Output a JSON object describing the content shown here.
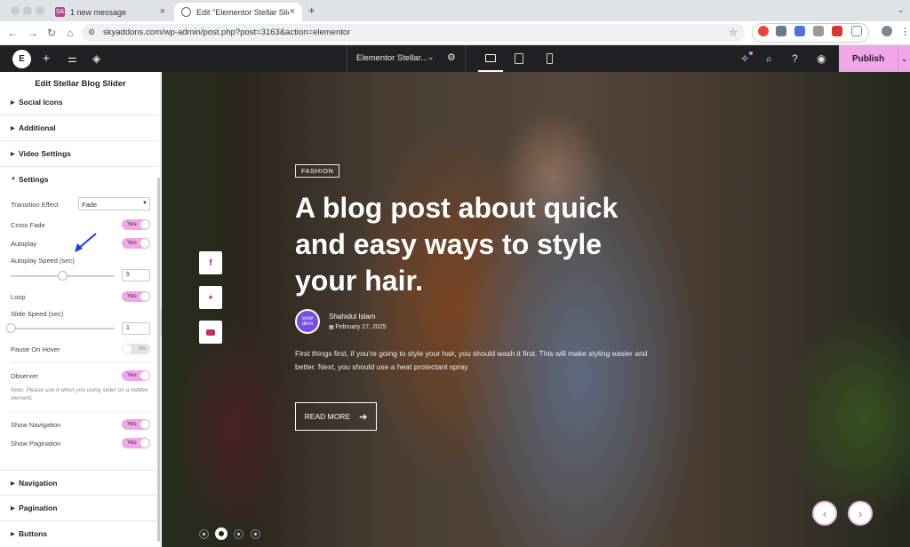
{
  "browser": {
    "tabs": [
      {
        "label": "1 new message",
        "favicon": "SA"
      },
      {
        "label": "Edit \"Elementor Stellar Slider\"",
        "favicon": "globe"
      }
    ],
    "new_tab": "+",
    "url": "skyaddons.com/wp-admin/post.php?post=3163&action=elementor"
  },
  "editor_bar": {
    "page_title": "Elementor Stellar...",
    "publish_label": "Publish"
  },
  "panel": {
    "title": "Edit Stellar Blog Slider",
    "sections_top": [
      "Social Icons",
      "Additional",
      "Video Settings"
    ],
    "settings_label": "Settings",
    "transition_effect_label": "Transition Effect",
    "transition_effect_value": "Fade",
    "cross_fade_label": "Cross Fade",
    "cross_fade_value": "Yes",
    "autoplay_label": "Autoplay",
    "autoplay_value": "Yes",
    "autoplay_speed_label": "Autoplay Speed (sec)",
    "autoplay_speed_value": "5",
    "loop_label": "Loop",
    "loop_value": "Yes",
    "slide_speed_label": "Slide Speed (sec)",
    "slide_speed_value": "1",
    "pause_hover_label": "Pause On Hover",
    "pause_hover_value": "No",
    "observer_label": "Observer",
    "observer_value": "Yes",
    "observer_note": "Note: Please use it when you using slider on a hidden element.",
    "show_navigation_label": "Show Navigation",
    "show_navigation_value": "Yes",
    "show_pagination_label": "Show Pagination",
    "show_pagination_value": "Yes",
    "sections_bottom": [
      "Navigation",
      "Pagination",
      "Buttons"
    ]
  },
  "slide": {
    "category": "FASHION",
    "title": "A blog post about quick and easy ways to style your hair.",
    "author_avatar_text": "wow devs",
    "author": "Shahidul Islam",
    "date": "February 27, 2025",
    "excerpt": "First things first, if you're going to style your hair, you should wash it first. This will make styling easier and better. Next, you should use a heat protectant spray",
    "read_more": "READ MORE"
  },
  "colors": {
    "accent_pink": "#f0a6e8",
    "editor_dark": "#1f2124"
  }
}
